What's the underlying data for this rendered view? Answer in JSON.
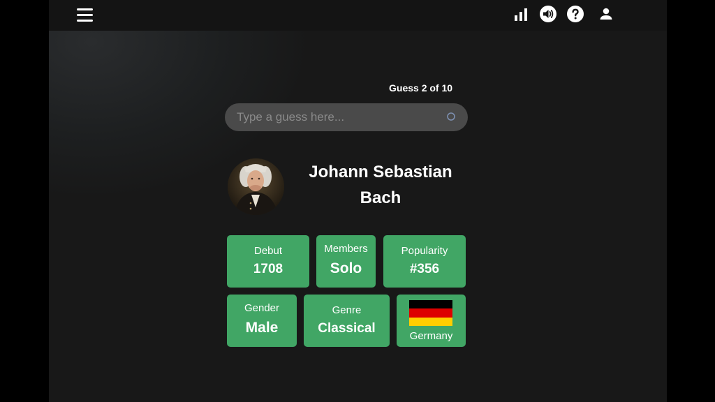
{
  "topbar": {
    "menu_icon": "hamburger-menu-icon",
    "icons": [
      "stats-icon",
      "sound-icon",
      "help-icon",
      "user-icon"
    ]
  },
  "game": {
    "guess_counter": "Guess 2 of 10",
    "search_placeholder": "Type a guess here..."
  },
  "artist": {
    "name_line1": "Johann Sebastian",
    "name_line2": "Bach",
    "avatar": "portrait-avatar"
  },
  "tiles": {
    "debut": {
      "label": "Debut",
      "value": "1708"
    },
    "members": {
      "label": "Members",
      "value": "Solo"
    },
    "popularity": {
      "label": "Popularity",
      "value": "#356"
    },
    "gender": {
      "label": "Gender",
      "value": "Male"
    },
    "genre": {
      "label": "Genre",
      "value": "Classical"
    },
    "country": {
      "label": "Germany",
      "flag": "germany-flag-icon"
    }
  },
  "colors": {
    "tile_green": "#41a665",
    "background": "#181818",
    "topbar": "#141414",
    "search_bg": "#4a4a4a",
    "flag_black": "#000000",
    "flag_red": "#dd0000",
    "flag_gold": "#ffce00"
  }
}
